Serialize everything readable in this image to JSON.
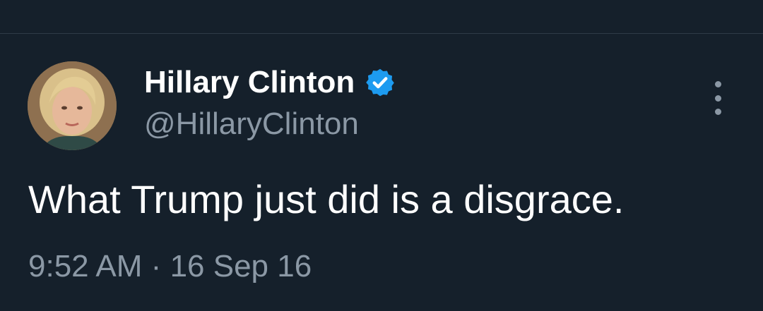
{
  "tweet": {
    "display_name": "Hillary Clinton",
    "handle": "@HillaryClinton",
    "text": "What Trump just did is a disgrace.",
    "time": "9:52 AM",
    "separator": "·",
    "date": "16 Sep 16",
    "verified_icon": "verified-badge-icon",
    "more_icon": "more-options-icon"
  },
  "colors": {
    "background": "#15202b",
    "primary_text": "#ffffff",
    "secondary_text": "#8b98a5",
    "verified_blue": "#1d9bf0"
  }
}
